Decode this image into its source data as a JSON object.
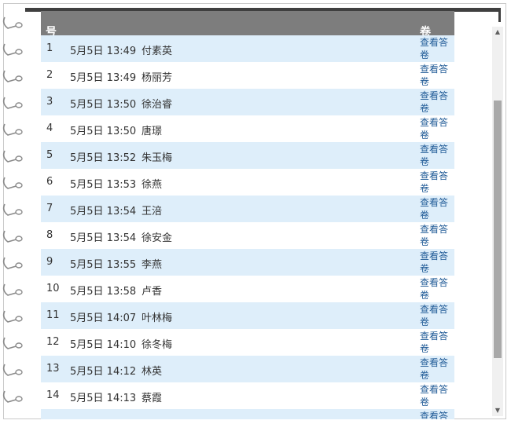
{
  "header": {
    "idx": "号",
    "time": "",
    "name": "",
    "action": "卷"
  },
  "rows": [
    {
      "idx": "1",
      "time": "5月5日 13:49",
      "name": "付素英",
      "link": "查看答卷"
    },
    {
      "idx": "2",
      "time": "5月5日 13:49",
      "name": "杨丽芳",
      "link": "查看答卷"
    },
    {
      "idx": "3",
      "time": "5月5日 13:50",
      "name": "徐治睿",
      "link": "查看答卷"
    },
    {
      "idx": "4",
      "time": "5月5日 13:50",
      "name": "唐璟",
      "link": "查看答卷"
    },
    {
      "idx": "5",
      "time": "5月5日 13:52",
      "name": "朱玉梅",
      "link": "查看答卷"
    },
    {
      "idx": "6",
      "time": "5月5日 13:53",
      "name": "徐燕",
      "link": "查看答卷"
    },
    {
      "idx": "7",
      "time": "5月5日 13:54",
      "name": "王涪",
      "link": "查看答卷"
    },
    {
      "idx": "8",
      "time": "5月5日 13:54",
      "name": "徐安金",
      "link": "查看答卷"
    },
    {
      "idx": "9",
      "time": "5月5日 13:55",
      "name": "李燕",
      "link": "查看答卷"
    },
    {
      "idx": "10",
      "time": "5月5日 13:58",
      "name": "卢香",
      "link": "查看答卷"
    },
    {
      "idx": "11",
      "time": "5月5日 14:07",
      "name": "叶林梅",
      "link": "查看答卷"
    },
    {
      "idx": "12",
      "time": "5月5日 14:10",
      "name": "徐冬梅",
      "link": "查看答卷"
    },
    {
      "idx": "13",
      "time": "5月5日 14:12",
      "name": "林英",
      "link": "查看答卷"
    },
    {
      "idx": "14",
      "time": "5月5日 14:13",
      "name": "蔡霞",
      "link": "查看答卷"
    },
    {
      "idx": "",
      "time": "",
      "name": "",
      "link": "查看答卷"
    }
  ],
  "scrollbar": {
    "up_icon": "scroll-up-arrow",
    "down_icon": "scroll-down-arrow",
    "scroll_position": 0.19
  }
}
